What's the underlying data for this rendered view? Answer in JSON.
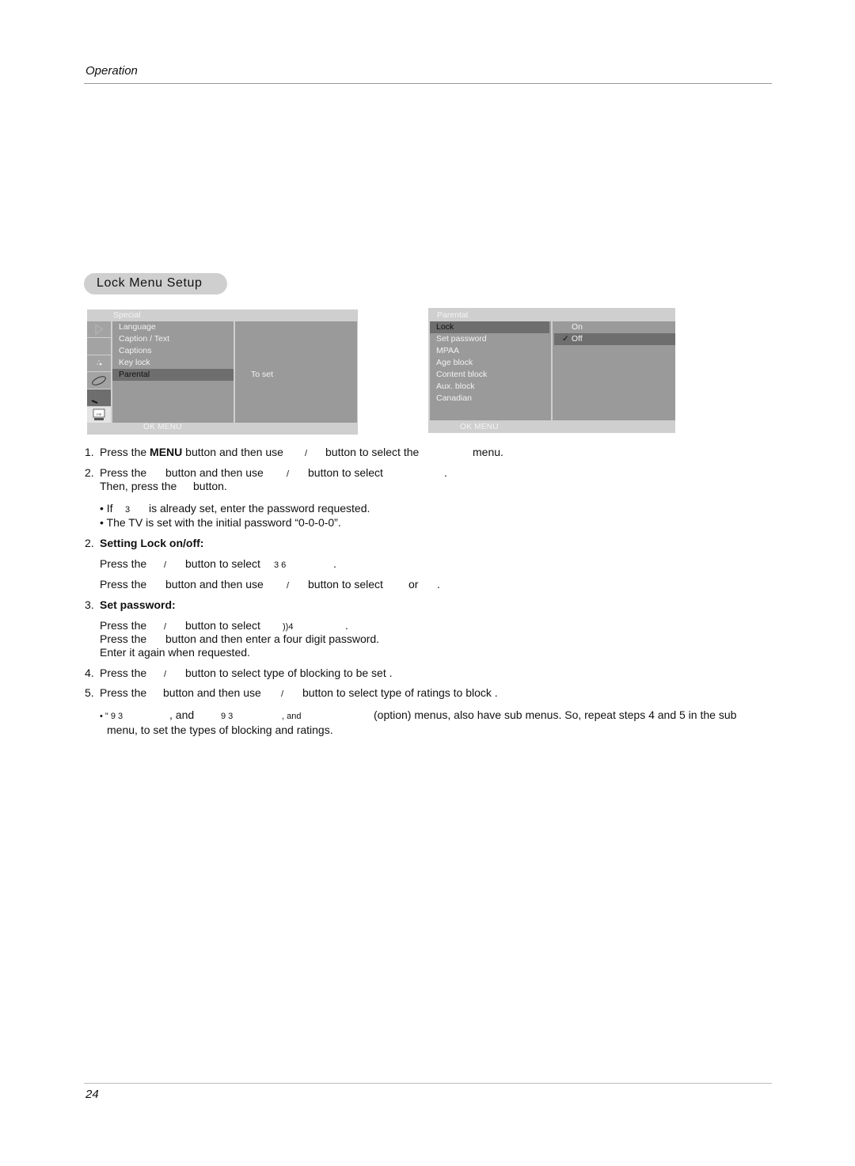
{
  "header": {
    "section_title": "Operation"
  },
  "section": {
    "title": "Lock Menu Setup"
  },
  "osd_special": {
    "title": "Special",
    "items": [
      "Language",
      "Caption / Text",
      "Captions",
      "Key lock",
      "Parental"
    ],
    "selected_index": 4,
    "right_panel_text": "To set",
    "footer": "OK   MENU",
    "icons": [
      "picture-icon",
      "sound-icon",
      "time-icon",
      "special-icon",
      "screen-icon",
      "pip-icon"
    ]
  },
  "osd_parental": {
    "title": "Parental",
    "items": [
      "Lock",
      "Set password",
      "MPAA",
      "Age block",
      "Content block",
      "Aux. block",
      "Canadian"
    ],
    "selected_index": 0,
    "options": [
      "On",
      "Off"
    ],
    "checked_option": "Off",
    "check_mark": "✓",
    "footer": "OK   MENU"
  },
  "instructions": {
    "step1": {
      "num": "1.",
      "a": "Press the ",
      "bold": "MENU",
      "b": " button and then use",
      "slash": "/",
      "c": "button to select the",
      "d": "menu."
    },
    "step2": {
      "num": "2.",
      "a": "Press the",
      "b": "button and then use",
      "slash": "/",
      "c": "button to select",
      "d": ".",
      "line2": "Then, press the",
      "line2b": "button."
    },
    "bullet1": {
      "a": "• If",
      "code": "3",
      "b": "is already set, enter the password requested."
    },
    "bullet2": "• The TV is set with the initial password “0-0-0-0”.",
    "heading2": {
      "num": "2.",
      "text": "Setting Lock on/off:"
    },
    "lock_line1": {
      "a": "Press the",
      "slash": "/",
      "b": "button to select",
      "code": "3   6",
      "c": "."
    },
    "lock_line2": {
      "a": "Press the",
      "b": "button and then use",
      "slash": "/",
      "c": "button to select",
      "d": "or",
      "e": "."
    },
    "heading3": {
      "num": "3.",
      "text": "Set password:"
    },
    "pw_line1": {
      "a": "Press the",
      "slash": "/",
      "b": "button to select",
      "code": "))4",
      "c": "."
    },
    "pw_line2": {
      "a": "Press the",
      "b": "button and then enter a four digit password."
    },
    "pw_line3": "Enter it again when requested.",
    "step4": {
      "num": "4.",
      "a": "Press the",
      "slash": "/",
      "b": "button to select type of blocking to be set ."
    },
    "step5": {
      "num": "5.",
      "a": "Press the",
      "b": "button and then use",
      "slash": "/",
      "c": "button to select type of ratings to block ."
    },
    "note": {
      "a": "• \"   9   3",
      "b": ", and",
      "c": "9   3",
      "d": ", and",
      "e": "(option) menus, also have sub menus. So, repeat steps 4 and 5 in the sub",
      "line2": "menu, to set the types of blocking and ratings."
    }
  },
  "footer": {
    "page_number": "24"
  }
}
